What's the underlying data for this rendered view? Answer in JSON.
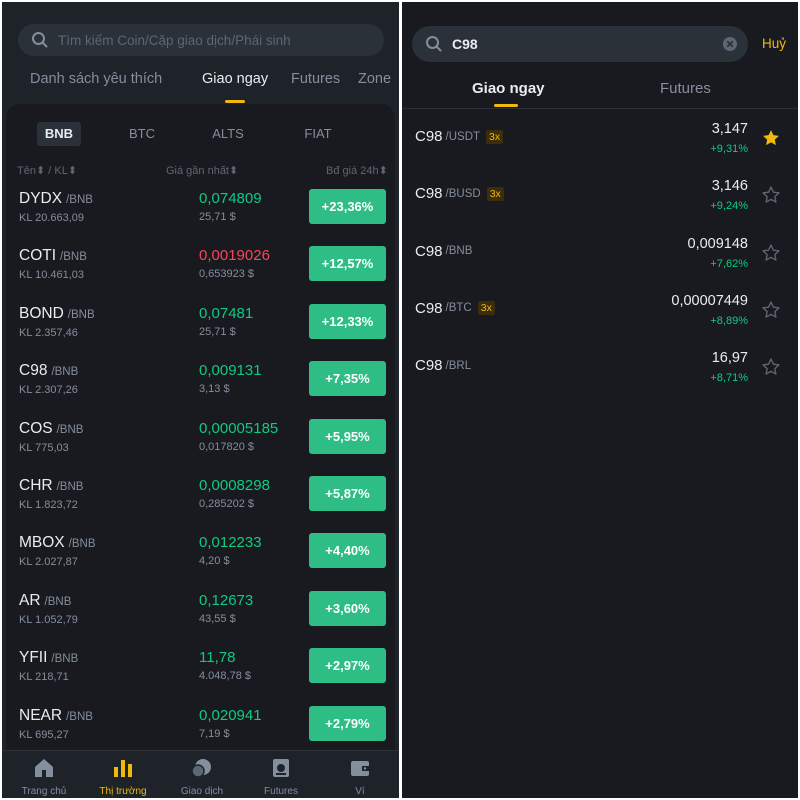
{
  "left": {
    "search": {
      "placeholder": "Tìm kiếm Coin/Cặp giao dịch/Phái sinh",
      "icon": "search-icon"
    },
    "top_tabs": [
      {
        "label": "Danh sách yêu thích",
        "active": false
      },
      {
        "label": "Giao ngay",
        "active": true
      },
      {
        "label": "Futures",
        "active": false
      },
      {
        "label": "Zone",
        "active": false
      }
    ],
    "quote_tabs": [
      {
        "label": "BNB",
        "active": true
      },
      {
        "label": "BTC",
        "active": false
      },
      {
        "label": "ALTS",
        "active": false
      },
      {
        "label": "FIAT",
        "active": false
      }
    ],
    "columns": {
      "name": "Tên",
      "sep": "/",
      "vol": "KL",
      "price": "Giá gần nhất",
      "change": "Bđ giá 24h"
    },
    "rows": [
      {
        "base": "DYDX",
        "quote": "/BNB",
        "vol": "KL 20.663,09",
        "price": "0,074809",
        "usd": "25,71 $",
        "change": "+23,36%",
        "direction": "up"
      },
      {
        "base": "COTI",
        "quote": "/BNB",
        "vol": "KL 10.461,03",
        "price": "0,0019026",
        "usd": "0,653923 $",
        "change": "+12,57%",
        "direction": "down"
      },
      {
        "base": "BOND",
        "quote": "/BNB",
        "vol": "KL 2.357,46",
        "price": "0,07481",
        "usd": "25,71 $",
        "change": "+12,33%",
        "direction": "up"
      },
      {
        "base": "C98",
        "quote": "/BNB",
        "vol": "KL 2.307,26",
        "price": "0,009131",
        "usd": "3,13 $",
        "change": "+7,35%",
        "direction": "up"
      },
      {
        "base": "COS",
        "quote": "/BNB",
        "vol": "KL 775,03",
        "price": "0,00005185",
        "usd": "0,017820 $",
        "change": "+5,95%",
        "direction": "up"
      },
      {
        "base": "CHR",
        "quote": "/BNB",
        "vol": "KL 1.823,72",
        "price": "0,0008298",
        "usd": "0,285202 $",
        "change": "+5,87%",
        "direction": "up"
      },
      {
        "base": "MBOX",
        "quote": "/BNB",
        "vol": "KL 2.027,87",
        "price": "0,012233",
        "usd": "4,20 $",
        "change": "+4,40%",
        "direction": "up"
      },
      {
        "base": "AR",
        "quote": "/BNB",
        "vol": "KL 1.052,79",
        "price": "0,12673",
        "usd": "43,55 $",
        "change": "+3,60%",
        "direction": "up"
      },
      {
        "base": "YFII",
        "quote": "/BNB",
        "vol": "KL 218,71",
        "price": "11,78",
        "usd": "4.048,78 $",
        "change": "+2,97%",
        "direction": "up"
      },
      {
        "base": "NEAR",
        "quote": "/BNB",
        "vol": "KL 695,27",
        "price": "0,020941",
        "usd": "7,19 $",
        "change": "+2,79%",
        "direction": "up"
      }
    ],
    "nav": [
      {
        "label": "Trang chủ",
        "icon": "home-icon",
        "active": false
      },
      {
        "label": "Thị trường",
        "icon": "markets-icon",
        "active": true
      },
      {
        "label": "Giao dịch",
        "icon": "trade-icon",
        "active": false
      },
      {
        "label": "Futures",
        "icon": "futures-icon",
        "active": false
      },
      {
        "label": "Ví",
        "icon": "wallet-icon",
        "active": false
      }
    ]
  },
  "right": {
    "search": {
      "value": "C98",
      "icon": "search-icon",
      "clear_icon": "clear-icon"
    },
    "cancel_label": "Huỷ",
    "tabs": [
      {
        "label": "Giao ngay",
        "active": true
      },
      {
        "label": "Futures",
        "active": false
      }
    ],
    "results": [
      {
        "base": "C98",
        "quote": "/USDT",
        "leverage": "3x",
        "price": "3,147",
        "change": "+9,31%",
        "favorite": true
      },
      {
        "base": "C98",
        "quote": "/BUSD",
        "leverage": "3x",
        "price": "3,146",
        "change": "+9,24%",
        "favorite": false
      },
      {
        "base": "C98",
        "quote": "/BNB",
        "leverage": "",
        "price": "0,009148",
        "change": "+7,62%",
        "favorite": false
      },
      {
        "base": "C98",
        "quote": "/BTC",
        "leverage": "3x",
        "price": "0,00007449",
        "change": "+8,89%",
        "favorite": false
      },
      {
        "base": "C98",
        "quote": "/BRL",
        "leverage": "",
        "price": "16,97",
        "change": "+8,71%",
        "favorite": false
      }
    ]
  },
  "colors": {
    "accent": "#f0b90b",
    "up": "#0ecb81",
    "down": "#f6465d",
    "up_button": "#2ebd85",
    "panel_bg": "#1e2329",
    "list_bg": "#181a20"
  }
}
